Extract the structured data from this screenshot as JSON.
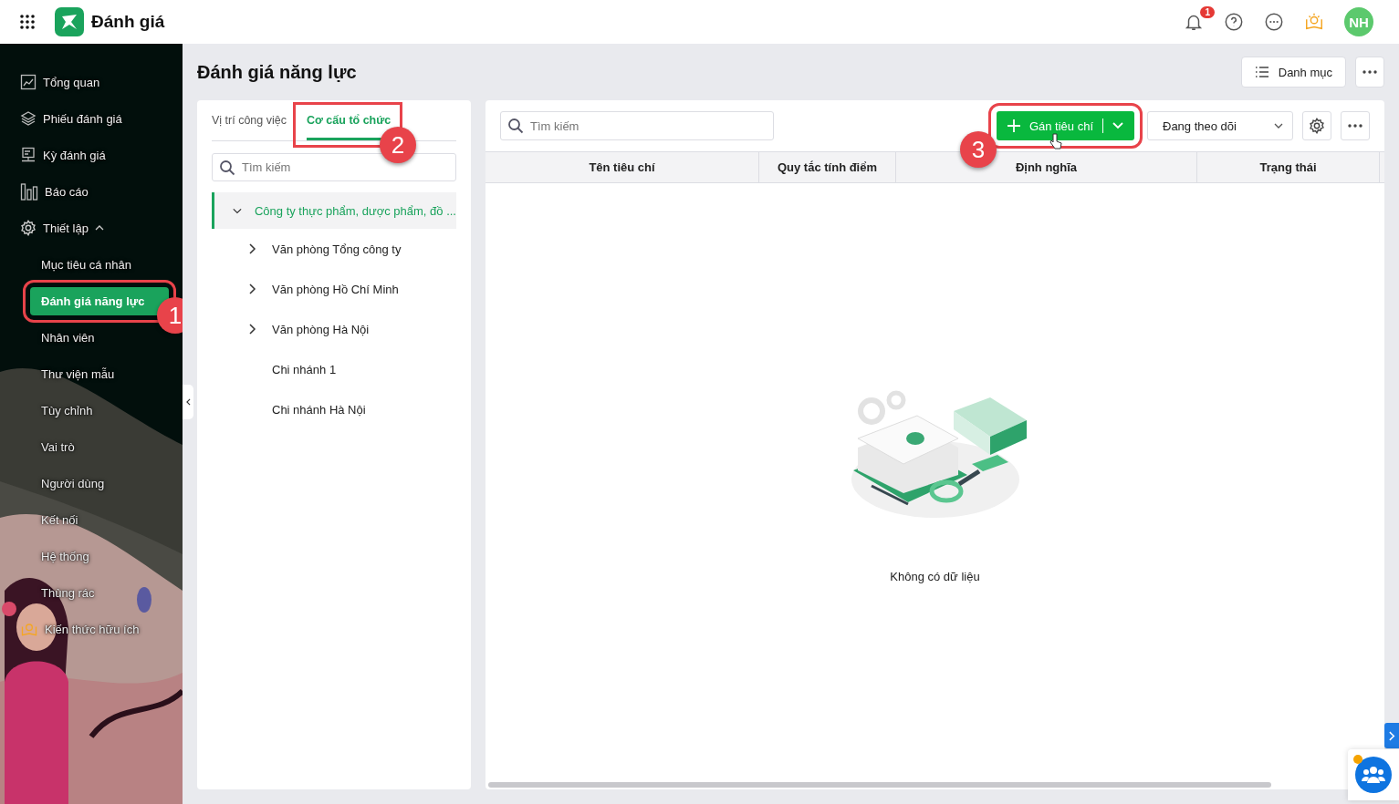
{
  "header": {
    "app_title": "Đánh giá",
    "notification_count": "1",
    "avatar_initials": "NH"
  },
  "sidebar": {
    "items": [
      {
        "label": "Tổng quan",
        "selected": false
      },
      {
        "label": "Phiếu đánh giá",
        "selected": false
      },
      {
        "label": "Kỳ đánh giá",
        "selected": false
      },
      {
        "label": "Báo cáo",
        "selected": false
      },
      {
        "label": "Thiết lập",
        "selected": false,
        "expanded": true,
        "children": [
          {
            "label": "Mục tiêu cá nhân",
            "selected": false
          },
          {
            "label": "Đánh giá năng lực",
            "selected": true,
            "callout": "1"
          },
          {
            "label": "Nhân viên",
            "selected": false
          },
          {
            "label": "Thư viện mẫu",
            "selected": false
          },
          {
            "label": "Tùy chỉnh",
            "selected": false
          },
          {
            "label": "Vai trò",
            "selected": false
          },
          {
            "label": "Người dùng",
            "selected": false
          },
          {
            "label": "Kết nối",
            "selected": false
          },
          {
            "label": "Hệ thống",
            "selected": false
          },
          {
            "label": "Thùng rác",
            "selected": false
          }
        ]
      },
      {
        "label": "Kiến thức hữu ích",
        "selected": false
      }
    ]
  },
  "page": {
    "title": "Đánh giá năng lực",
    "category_button": "Danh mục"
  },
  "left_panel": {
    "tabs": [
      {
        "label": "Vị trí công việc",
        "selected": false
      },
      {
        "label": "Cơ cấu tổ chức",
        "selected": true,
        "callout": "2"
      }
    ],
    "search": {
      "placeholder": "Tìm kiếm"
    },
    "tree": [
      {
        "label": "Công ty thực phẩm, dược phẩm, đồ ...",
        "kind": "branch",
        "expanded": true,
        "selected": true,
        "children": [
          {
            "label": "Văn phòng Tổng công ty",
            "kind": "branch",
            "expanded": false,
            "selected": false
          },
          {
            "label": "Văn phòng Hồ Chí Minh",
            "kind": "branch",
            "expanded": false,
            "selected": false
          },
          {
            "label": "Văn phòng Hà Nội",
            "kind": "branch",
            "expanded": false,
            "selected": false
          },
          {
            "label": "Chi nhánh 1",
            "kind": "leaf",
            "selected": false
          },
          {
            "label": "Chi nhánh Hà Nội",
            "kind": "leaf",
            "selected": false
          }
        ]
      }
    ]
  },
  "right_panel": {
    "search": {
      "placeholder": "Tìm kiếm"
    },
    "assign_button": {
      "label": "Gán tiêu chí",
      "callout": "3"
    },
    "filter": {
      "value": "Đang theo dõi"
    },
    "table": {
      "columns": [
        "Tên tiêu chí",
        "Quy tắc tính điểm",
        "Định nghĩa",
        "Trạng thái"
      ]
    },
    "empty_text": "Không có dữ liệu"
  }
}
